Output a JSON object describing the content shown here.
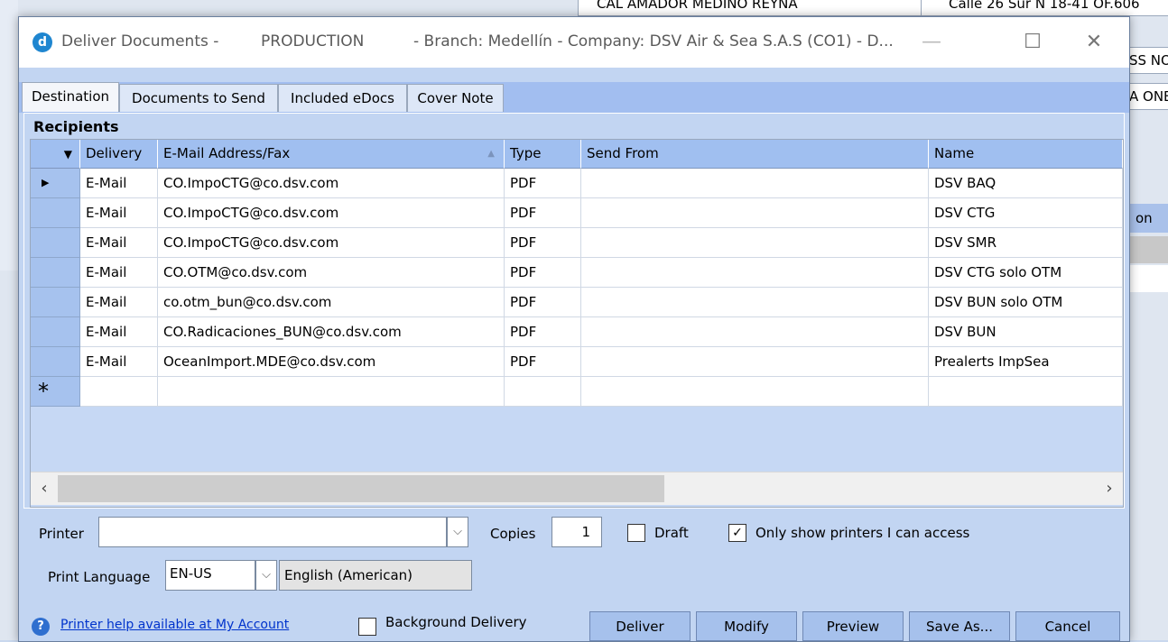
{
  "background_app": {
    "frag_top": "CAL AMADOR MEDINO REYNA",
    "frag_top_right": "Calle 26 Sur N 18-41 OF.606",
    "frag_right_1": "SS NO",
    "frag_right_2": "A ONE",
    "frag_right_3": "on"
  },
  "window": {
    "title": "Deliver Documents -",
    "environment": "PRODUCTION",
    "context": "- Branch: Medellín - Company: DSV Air & Sea S.A.S (CO1) - D..."
  },
  "tabs": [
    "Destination",
    "Documents to Send",
    "Included eDocs",
    "Cover Note"
  ],
  "recipients": {
    "title": "Recipients",
    "columns": {
      "delivery": "Delivery",
      "address": "E-Mail Address/Fax",
      "type": "Type",
      "send_from": "Send From",
      "name": "Name"
    },
    "rows": [
      {
        "delivery": "E-Mail",
        "address": "CO.ImpoCTG@co.dsv.com",
        "type": "PDF",
        "send_from": "",
        "name": "DSV BAQ"
      },
      {
        "delivery": "E-Mail",
        "address": "CO.ImpoCTG@co.dsv.com",
        "type": "PDF",
        "send_from": "",
        "name": "DSV CTG"
      },
      {
        "delivery": "E-Mail",
        "address": "CO.ImpoCTG@co.dsv.com",
        "type": "PDF",
        "send_from": "",
        "name": "DSV SMR"
      },
      {
        "delivery": "E-Mail",
        "address": "CO.OTM@co.dsv.com",
        "type": "PDF",
        "send_from": "",
        "name": "DSV CTG solo OTM"
      },
      {
        "delivery": "E-Mail",
        "address": "co.otm_bun@co.dsv.com",
        "type": "PDF",
        "send_from": "",
        "name": "DSV BUN solo OTM"
      },
      {
        "delivery": "E-Mail",
        "address": "CO.Radicaciones_BUN@co.dsv.com",
        "type": "PDF",
        "send_from": "",
        "name": "DSV BUN"
      },
      {
        "delivery": "E-Mail",
        "address": "OceanImport.MDE@co.dsv.com",
        "type": "PDF",
        "send_from": "",
        "name": "Prealerts ImpSea"
      }
    ],
    "new_row_marker": "*"
  },
  "printer": {
    "label": "Printer",
    "value": "",
    "copies_label": "Copies",
    "copies": "1",
    "draft_label": "Draft",
    "draft_checked": false,
    "only_access_label": "Only show printers I can access",
    "only_access_checked": true
  },
  "print_language": {
    "label": "Print Language",
    "code": "EN-US",
    "name": "English (American)"
  },
  "help_link": "Printer help available at My Account",
  "background_delivery": {
    "label": "Background Delivery",
    "checked": false
  },
  "buttons": {
    "deliver": "Deliver",
    "modify": "Modify",
    "preview": "Preview",
    "save_as": "Save As...",
    "cancel": "Cancel"
  },
  "colors": {
    "dialog_bg": "#c2d5f2",
    "header_bg": "#a0bff0",
    "button_bg": "#a6c1ec",
    "link": "#0033cc"
  }
}
